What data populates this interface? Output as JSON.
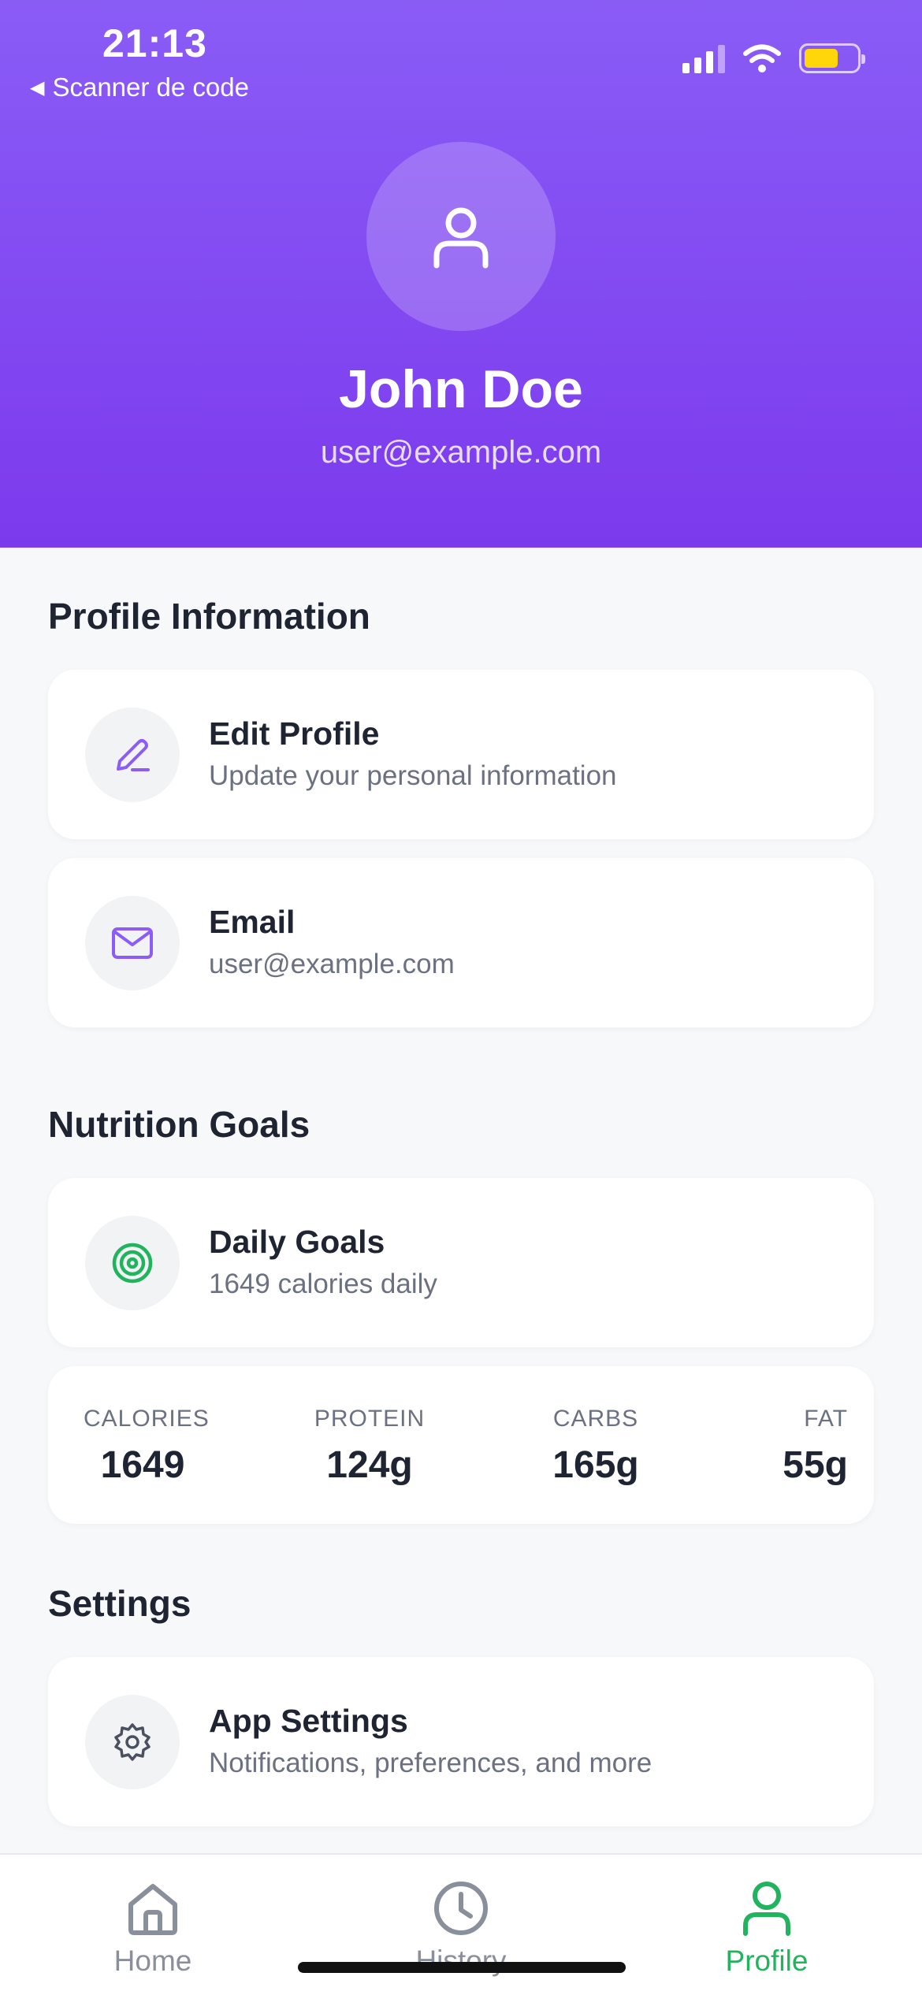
{
  "status_bar": {
    "time": "21:13",
    "back_app": "Scanner de code"
  },
  "profile": {
    "name": "John Doe",
    "email": "user@example.com"
  },
  "sections": {
    "profile_info": {
      "title": "Profile Information",
      "edit_profile": {
        "title": "Edit Profile",
        "subtitle": "Update your personal information",
        "icon": "pencil-icon"
      },
      "email": {
        "title": "Email",
        "subtitle": "user@example.com",
        "icon": "mail-icon"
      }
    },
    "nutrition": {
      "title": "Nutrition Goals",
      "daily_goals": {
        "title": "Daily Goals",
        "subtitle": "1649 calories daily",
        "icon": "target-icon"
      },
      "macros": [
        {
          "label": "CALORIES",
          "value": "1649"
        },
        {
          "label": "PROTEIN",
          "value": "124g"
        },
        {
          "label": "CARBS",
          "value": "165g"
        },
        {
          "label": "FAT",
          "value": "55g"
        }
      ]
    },
    "settings": {
      "title": "Settings",
      "app_settings": {
        "title": "App Settings",
        "subtitle": "Notifications, preferences, and more",
        "icon": "gear-icon"
      }
    }
  },
  "tabbar": [
    {
      "label": "Home",
      "icon": "home-icon",
      "active": false
    },
    {
      "label": "History",
      "icon": "clock-icon",
      "active": false
    },
    {
      "label": "Profile",
      "icon": "user-icon",
      "active": true
    }
  ],
  "colors": {
    "accent": "#7c3aed",
    "active_tab": "#22b35e",
    "muted": "#6b7180"
  }
}
